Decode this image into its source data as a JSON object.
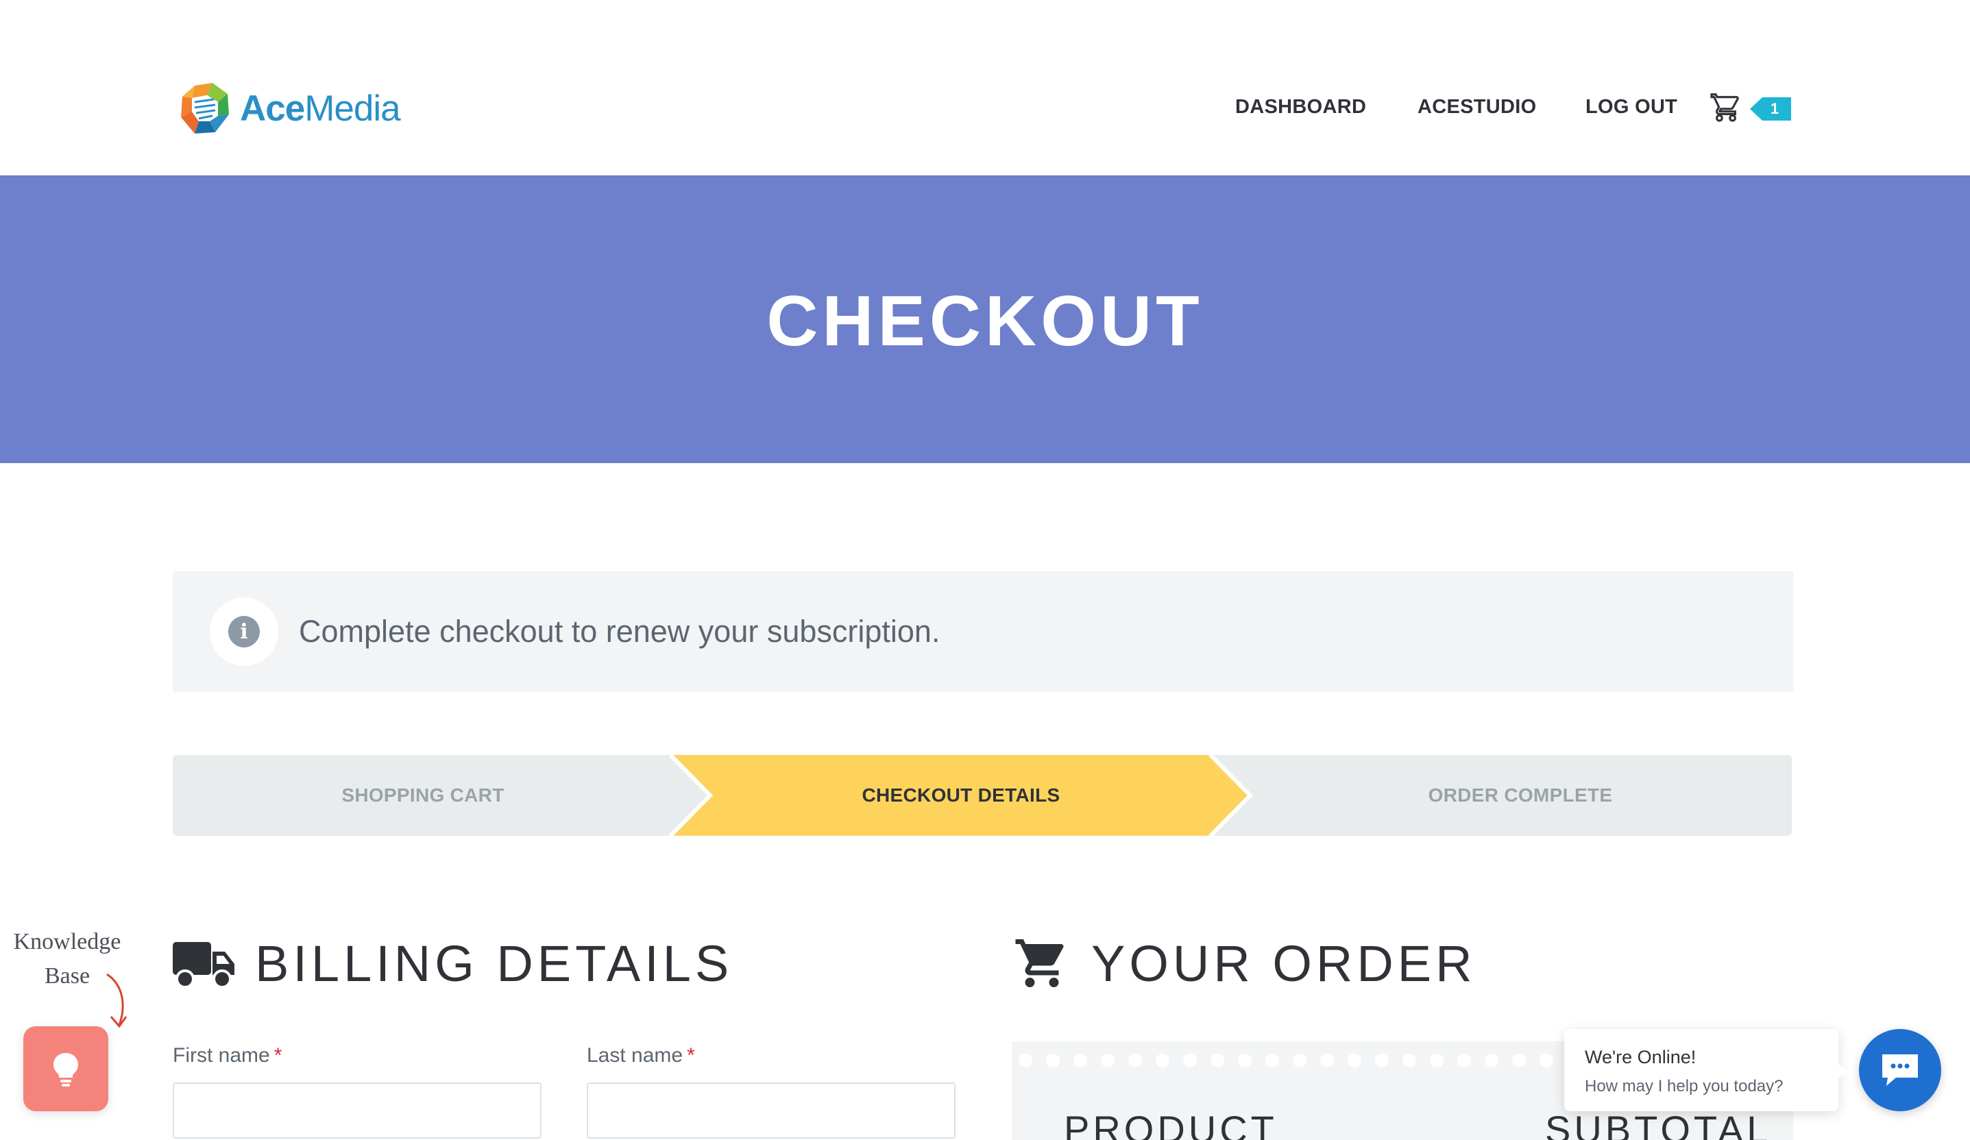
{
  "header": {
    "logo": {
      "part1": "Ace",
      "part2": "Media"
    },
    "nav": [
      {
        "label": "DASHBOARD"
      },
      {
        "label": "ACESTUDIO"
      },
      {
        "label": "LOG OUT"
      }
    ],
    "cart": {
      "count": "1",
      "icon": "cart-icon",
      "badge_color": "#1fb5d5"
    }
  },
  "hero": {
    "title": "CHECKOUT",
    "background": "#6e7fcb"
  },
  "notice": {
    "icon": "info-icon",
    "text": "Complete checkout to renew your subscription."
  },
  "steps": [
    {
      "label": "SHOPPING CART",
      "state": "done"
    },
    {
      "label": "CHECKOUT DETAILS",
      "state": "active"
    },
    {
      "label": "ORDER COMPLETE",
      "state": "pending"
    }
  ],
  "steps_active_color": "#fdd35c",
  "billing": {
    "title": "BILLING DETAILS",
    "icon": "truck-icon",
    "fields": [
      {
        "label": "First name",
        "required": "*",
        "value": ""
      },
      {
        "label": "Last name",
        "required": "*",
        "value": ""
      }
    ]
  },
  "order": {
    "title": "YOUR ORDER",
    "icon": "cart-icon",
    "columns": [
      "PRODUCT",
      "SUBTOTAL"
    ]
  },
  "knowledge_base": {
    "label_line1": "Knowledge",
    "label_line2": "Base",
    "icon": "lightbulb-icon",
    "color": "#f4837b"
  },
  "chat": {
    "title": "We're Online!",
    "subtitle": "How may I help you today?",
    "icon": "chat-icon",
    "color": "#1f6fd1"
  }
}
